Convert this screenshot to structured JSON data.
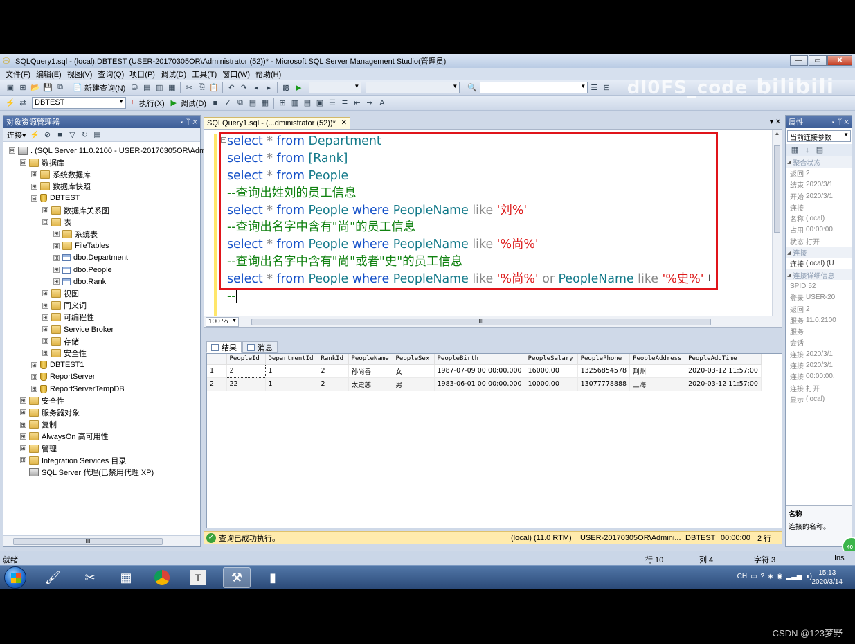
{
  "window": {
    "title": "SQLQuery1.sql - (local).DBTEST (USER-20170305OR\\Administrator (52))* - Microsoft SQL Server Management Studio(管理员)",
    "buttons": [
      "—",
      "▭",
      "✕"
    ]
  },
  "menu": [
    "文件(F)",
    "编辑(E)",
    "视图(V)",
    "查询(Q)",
    "项目(P)",
    "调试(D)",
    "工具(T)",
    "窗口(W)",
    "帮助(H)"
  ],
  "toolbar1": {
    "new_query": "新建查询(N)"
  },
  "toolbar2": {
    "database": "DBTEST",
    "execute": "执行(X)",
    "debug": "调试(D)"
  },
  "watermark": {
    "text": "dl0FS_code",
    "logo": "bilibili"
  },
  "object_explorer": {
    "title": "对象资源管理器",
    "pin": "▾ ᛘ ✕",
    "connect": "连接▾",
    "tree": [
      {
        "label": ". (SQL Server 11.0.2100 - USER-20170305OR\\Adm",
        "level": 0,
        "exp": "⊟",
        "icon": "server-icon"
      },
      {
        "label": "数据库",
        "level": 1,
        "exp": "⊟",
        "icon": "folder-icon"
      },
      {
        "label": "系统数据库",
        "level": 2,
        "exp": "⊞",
        "icon": "folder-icon"
      },
      {
        "label": "数据库快照",
        "level": 2,
        "exp": "⊞",
        "icon": "folder-icon"
      },
      {
        "label": "DBTEST",
        "level": 2,
        "exp": "⊟",
        "icon": "database-icon"
      },
      {
        "label": "数据库关系图",
        "level": 3,
        "exp": "⊞",
        "icon": "folder-icon"
      },
      {
        "label": "表",
        "level": 3,
        "exp": "⊟",
        "icon": "folder-icon"
      },
      {
        "label": "系统表",
        "level": 4,
        "exp": "⊞",
        "icon": "folder-icon"
      },
      {
        "label": "FileTables",
        "level": 4,
        "exp": "⊞",
        "icon": "folder-icon"
      },
      {
        "label": "dbo.Department",
        "level": 4,
        "exp": "⊞",
        "icon": "table-icon"
      },
      {
        "label": "dbo.People",
        "level": 4,
        "exp": "⊞",
        "icon": "table-icon"
      },
      {
        "label": "dbo.Rank",
        "level": 4,
        "exp": "⊞",
        "icon": "table-icon"
      },
      {
        "label": "视图",
        "level": 3,
        "exp": "⊞",
        "icon": "folder-icon"
      },
      {
        "label": "同义词",
        "level": 3,
        "exp": "⊞",
        "icon": "folder-icon"
      },
      {
        "label": "可编程性",
        "level": 3,
        "exp": "⊞",
        "icon": "folder-icon"
      },
      {
        "label": "Service Broker",
        "level": 3,
        "exp": "⊞",
        "icon": "folder-icon"
      },
      {
        "label": "存储",
        "level": 3,
        "exp": "⊞",
        "icon": "folder-icon"
      },
      {
        "label": "安全性",
        "level": 3,
        "exp": "⊞",
        "icon": "folder-icon"
      },
      {
        "label": "DBTEST1",
        "level": 2,
        "exp": "⊞",
        "icon": "database-icon"
      },
      {
        "label": "ReportServer",
        "level": 2,
        "exp": "⊞",
        "icon": "database-icon"
      },
      {
        "label": "ReportServerTempDB",
        "level": 2,
        "exp": "⊞",
        "icon": "database-icon"
      },
      {
        "label": "安全性",
        "level": 1,
        "exp": "⊞",
        "icon": "folder-icon"
      },
      {
        "label": "服务器对象",
        "level": 1,
        "exp": "⊞",
        "icon": "folder-icon"
      },
      {
        "label": "复制",
        "level": 1,
        "exp": "⊞",
        "icon": "folder-icon"
      },
      {
        "label": "AlwaysOn 高可用性",
        "level": 1,
        "exp": "⊞",
        "icon": "folder-icon"
      },
      {
        "label": "管理",
        "level": 1,
        "exp": "⊞",
        "icon": "folder-icon"
      },
      {
        "label": "Integration Services 目录",
        "level": 1,
        "exp": "⊞",
        "icon": "folder-icon"
      },
      {
        "label": "SQL Server 代理(已禁用代理 XP)",
        "level": 1,
        "exp": "",
        "icon": "agent-icon"
      }
    ],
    "scroll_label": "III"
  },
  "editor": {
    "tab_label": "SQLQuery1.sql - (...dministrator (52))*",
    "tab_close": "✕",
    "zoom": "100 %",
    "scroll_label": "III",
    "lines": [
      [
        {
          "c": "kw",
          "t": "select "
        },
        {
          "c": "op",
          "t": "* "
        },
        {
          "c": "kw",
          "t": "from "
        },
        {
          "c": "id",
          "t": "Department"
        }
      ],
      [
        {
          "c": "kw",
          "t": "select "
        },
        {
          "c": "op",
          "t": "* "
        },
        {
          "c": "kw",
          "t": "from "
        },
        {
          "c": "id",
          "t": "[Rank]"
        }
      ],
      [
        {
          "c": "kw",
          "t": "select "
        },
        {
          "c": "op",
          "t": "* "
        },
        {
          "c": "kw",
          "t": "from "
        },
        {
          "c": "id",
          "t": "People"
        }
      ],
      [
        {
          "c": "cm",
          "t": "--查询出姓刘的员工信息"
        }
      ],
      [
        {
          "c": "kw",
          "t": "select "
        },
        {
          "c": "op",
          "t": "* "
        },
        {
          "c": "kw",
          "t": "from "
        },
        {
          "c": "id",
          "t": "People "
        },
        {
          "c": "kw",
          "t": "where "
        },
        {
          "c": "id",
          "t": "PeopleName "
        },
        {
          "c": "op",
          "t": "like "
        },
        {
          "c": "str",
          "t": "'刘%'"
        }
      ],
      [
        {
          "c": "cm",
          "t": "--查询出名字中含有\"尚\"的员工信息"
        }
      ],
      [
        {
          "c": "kw",
          "t": "select "
        },
        {
          "c": "op",
          "t": "* "
        },
        {
          "c": "kw",
          "t": "from "
        },
        {
          "c": "id",
          "t": "People "
        },
        {
          "c": "kw",
          "t": "where "
        },
        {
          "c": "id",
          "t": "PeopleName "
        },
        {
          "c": "op",
          "t": "like "
        },
        {
          "c": "str",
          "t": "'%尚%'"
        }
      ],
      [
        {
          "c": "cm",
          "t": "--查询出名字中含有\"尚\"或者\"史\"的员工信息"
        }
      ],
      [
        {
          "c": "kw",
          "t": "select "
        },
        {
          "c": "op",
          "t": "* "
        },
        {
          "c": "kw",
          "t": "from "
        },
        {
          "c": "id",
          "t": "People "
        },
        {
          "c": "kw",
          "t": "where "
        },
        {
          "c": "id",
          "t": "PeopleName "
        },
        {
          "c": "op",
          "t": "like "
        },
        {
          "c": "str",
          "t": "'%尚%' "
        },
        {
          "c": "op",
          "t": "or "
        },
        {
          "c": "id",
          "t": "PeopleName "
        },
        {
          "c": "op",
          "t": "like "
        },
        {
          "c": "str",
          "t": "'%史%'"
        }
      ],
      [
        {
          "c": "cm",
          "t": "--"
        }
      ]
    ]
  },
  "results": {
    "tabs": [
      "结果",
      "消息"
    ],
    "columns": [
      "PeopleId",
      "DepartmentId",
      "RankId",
      "PeopleName",
      "PeopleSex",
      "PeopleBirth",
      "PeopleSalary",
      "PeoplePhone",
      "PeopleAddress",
      "PeopleAddTime"
    ],
    "rows": [
      {
        "n": "1",
        "cells": [
          "2",
          "1",
          "2",
          "孙尚香",
          "女",
          "1987-07-09 00:00:00.000",
          "16000.00",
          "13256854578",
          "荆州",
          "2020-03-12 11:57:00"
        ]
      },
      {
        "n": "2",
        "cells": [
          "22",
          "1",
          "2",
          "太史慈",
          "男",
          "1983-06-01 00:00:00.000",
          "10000.00",
          "13077778888",
          "上海",
          "2020-03-12 11:57:00"
        ]
      }
    ]
  },
  "query_status": {
    "message": "查询已成功执行。",
    "server": "(local) (11.0 RTM)",
    "user": "USER-20170305OR\\Admini...",
    "database": "DBTEST",
    "elapsed": "00:00:00",
    "rows": "2 行"
  },
  "properties": {
    "title": "属性",
    "pin": "▾ ᛘ ✕",
    "combo": "当前连接参数",
    "rows": [
      {
        "cat": true,
        "k": "聚合状态",
        "v": ""
      },
      {
        "k": "返回",
        "v": "2"
      },
      {
        "k": "结束",
        "v": "2020/3/1"
      },
      {
        "k": "开始",
        "v": "2020/3/1"
      },
      {
        "k": "连接",
        "v": ""
      },
      {
        "k": "名称",
        "v": "(local)"
      },
      {
        "k": "占用",
        "v": "00:00:00."
      },
      {
        "k": "状态",
        "v": "打开"
      },
      {
        "cat": true,
        "k": "连接",
        "v": ""
      },
      {
        "k": "连接",
        "v": "(local) (U",
        "dark": true
      },
      {
        "cat": true,
        "k": "连接详细信息",
        "v": ""
      },
      {
        "k": "SPID",
        "v": "52"
      },
      {
        "k": "登录",
        "v": "USER-20"
      },
      {
        "k": "返回",
        "v": "2"
      },
      {
        "k": "服务",
        "v": "11.0.2100"
      },
      {
        "k": "服务",
        "v": ""
      },
      {
        "k": "会话",
        "v": ""
      },
      {
        "k": "连接",
        "v": "2020/3/1"
      },
      {
        "k": "连接",
        "v": "2020/3/1"
      },
      {
        "k": "连接",
        "v": "00:00:00."
      },
      {
        "k": "连接",
        "v": "打开"
      },
      {
        "k": "显示",
        "v": "(local)"
      }
    ],
    "desc_title": "名称",
    "desc_text": "连接的名称。",
    "badge": "40"
  },
  "app_status": {
    "ready": "就绪",
    "line": "行 10",
    "col": "列 4",
    "ch": "字符 3",
    "mode": "Ins"
  },
  "taskbar": {
    "tray": "CH",
    "time": "15:13",
    "date": "2020/3/14"
  },
  "footer": "CSDN @123梦野"
}
